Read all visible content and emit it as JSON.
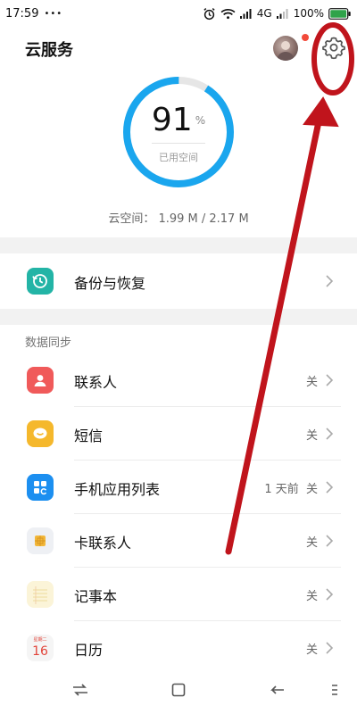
{
  "status_bar": {
    "time": "17:59",
    "dots": "•••",
    "network": "4G",
    "battery": "100%",
    "battery_color": "#2fa34a"
  },
  "header": {
    "title": "云服务",
    "avatar_dot_color": "#f24a3a"
  },
  "storage": {
    "percent": "91",
    "percent_symbol": "%",
    "used_label": "已用空间",
    "space_text": "云空间： 1.99 M / 2.17 M",
    "ring_fraction": 0.91,
    "ring_color": "#1aa6ee",
    "ring_track_color": "#e6e6e6"
  },
  "backup": {
    "label": "备份与恢复",
    "icon": "clock-restore-icon",
    "icon_color": "#23b4a6"
  },
  "data_sync": {
    "header": "数据同步",
    "items": [
      {
        "label": "联系人",
        "status": "关",
        "icon": "contact-icon",
        "color": "#f05a5a"
      },
      {
        "label": "短信",
        "status": "关",
        "icon": "message-icon",
        "color": "#f5b82c"
      },
      {
        "label": "手机应用列表",
        "status": "1 天前  关",
        "icon": "app-list-icon",
        "color": "#1c8ff0"
      },
      {
        "label": "卡联系人",
        "status": "关",
        "icon": "sim-card-icon",
        "color": "#eef0f4"
      },
      {
        "label": "记事本",
        "status": "关",
        "icon": "notepad-icon",
        "color": "#fbf4d8"
      },
      {
        "label": "日历",
        "status": "关",
        "icon": "calendar-icon",
        "color": "#f5f5f5",
        "calendar_day": "16",
        "calendar_top": "星期二"
      }
    ]
  },
  "annotation": {
    "color": "#c0141c"
  }
}
